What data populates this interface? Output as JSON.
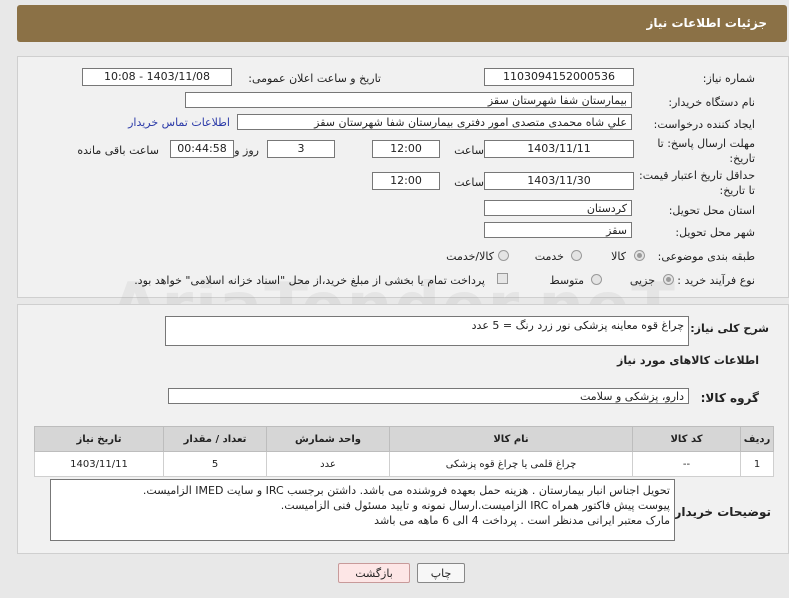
{
  "header": {
    "title": "جزئیات اطلاعات نیاز"
  },
  "form": {
    "need_number_label": "شماره نیاز:",
    "need_number": "1103094152000536",
    "announce_label": "تاریخ و ساعت اعلان عمومی:",
    "announce_value": "1403/11/08 - 10:08",
    "buyer_org_label": "نام دستگاه خریدار:",
    "buyer_org": "بیمارستان شفا شهرستان سقز",
    "creator_label": "ایجاد کننده درخواست:",
    "creator": "علي شاه محمدی متصدی امور دفتری بیمارستان شفا شهرستان سقز",
    "contact_link": "اطلاعات تماس خریدار",
    "reply_deadline_label": "مهلت ارسال پاسخ: تا تاریخ:",
    "reply_date": "1403/11/11",
    "time_label": "ساعت",
    "reply_time": "12:00",
    "days_value": "3",
    "days_label": "روز و",
    "remaining_time": "00:44:58",
    "remaining_label": "ساعت باقی مانده",
    "price_validity_label": "حداقل تاریخ اعتبار قیمت: تا تاریخ:",
    "price_date": "1403/11/30",
    "price_time": "12:00",
    "province_label": "استان محل تحویل:",
    "province": "کردستان",
    "city_label": "شهر محل تحویل:",
    "city": "سقز",
    "category_label": "طبقه بندی موضوعی:",
    "category_options": [
      "کالا",
      "خدمت",
      "کالا/خدمت"
    ],
    "category_selected": "کالا",
    "process_label": "نوع فرآیند خرید :",
    "process_options": [
      "جزیی",
      "متوسط"
    ],
    "process_selected": "جزیی",
    "payment_note": "پرداخت تمام یا بخشی از مبلغ خرید،از محل \"اسناد خزانه اسلامی\" خواهد بود."
  },
  "general_desc": {
    "label": "شرح کلی نیاز:",
    "value": "چراغ قوه معاینه پزشکی نور زرد رنگ = 5 عدد"
  },
  "goods_section_title": "اطلاعات کالاهای مورد نیاز",
  "goods_group": {
    "label": "گروه کالا:",
    "value": "دارو، پزشکی و سلامت"
  },
  "table": {
    "headers": [
      "ردیف",
      "کد کالا",
      "نام کالا",
      "واحد شمارش",
      "تعداد / مقدار",
      "تاریخ نیاز"
    ],
    "rows": [
      [
        "1",
        "--",
        "چراغ قلمی یا چراغ قوه پزشکی",
        "عدد",
        "5",
        "1403/11/11"
      ]
    ]
  },
  "buyer_notes": {
    "label": "توضیحات خریدار:",
    "lines": [
      "تحویل اجناس انبار بیمارستان . هزینه حمل بعهده فروشنده می باشد.  داشتن برجسب IRC  و سایت  IMED  الزامیست.",
      "پیوست پیش فاکتور همراه IRC  الزامیست.ارسال نمونه و تایید مسئول فنی الزامیست.",
      "مارک معتبر ایرانی مدنظر است . پرداخت 4 الی 6 ماهه می باشد"
    ]
  },
  "buttons": {
    "print": "چاپ",
    "back": "بازگشت"
  },
  "watermark": "AriaTender.neT"
}
